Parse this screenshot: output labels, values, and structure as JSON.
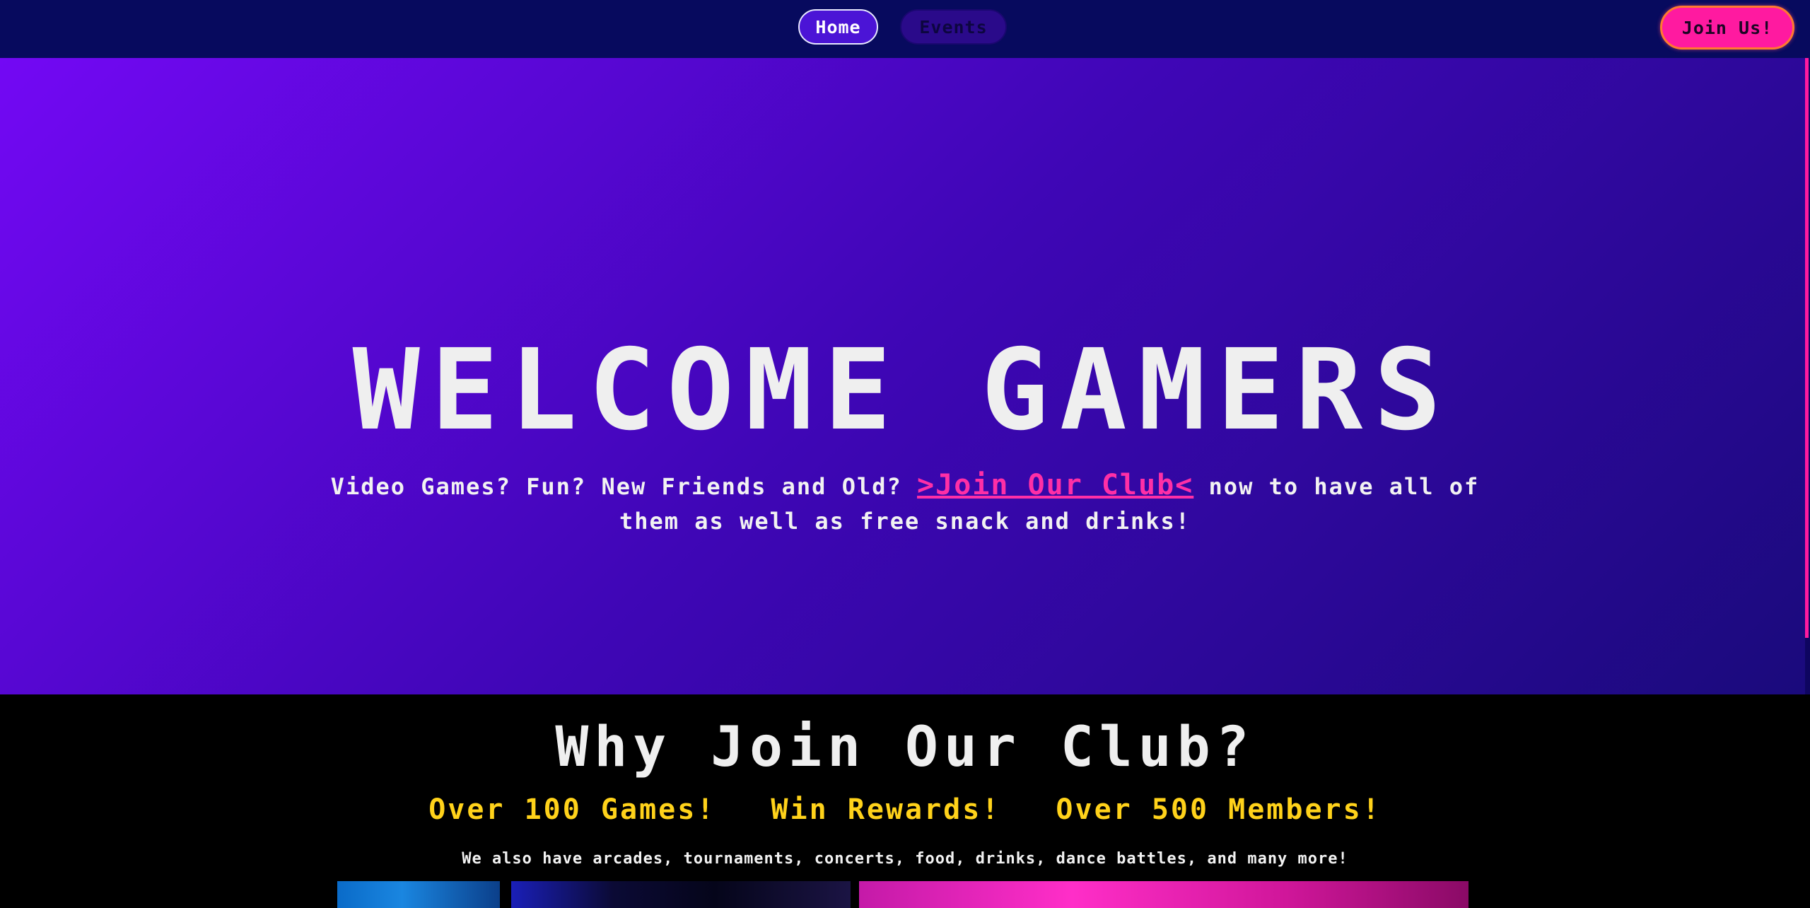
{
  "nav": {
    "home_label": "Home",
    "events_label": "Events",
    "join_label": "Join Us!"
  },
  "hero": {
    "title": "WELCOME GAMERS",
    "text_before": "Video Games? Fun? New Friends and Old? ",
    "link_label": ">Join Our Club<",
    "text_after": " now to have all of them as well as free snack and drinks!"
  },
  "why": {
    "title": "Why Join Our Club?",
    "features": [
      "Over 100 Games!",
      "Win Rewards!",
      "Over 500 Members!"
    ],
    "also": "We also have arcades, tournaments, concerts, food, drinks, dance battles, and many more!"
  },
  "colors": {
    "nav_bg": "#070a5e",
    "accent_pink": "#ff1aa0",
    "feature_yellow": "#ffd21a",
    "hero_start": "#7308f4",
    "hero_end": "#1a0a7c"
  }
}
